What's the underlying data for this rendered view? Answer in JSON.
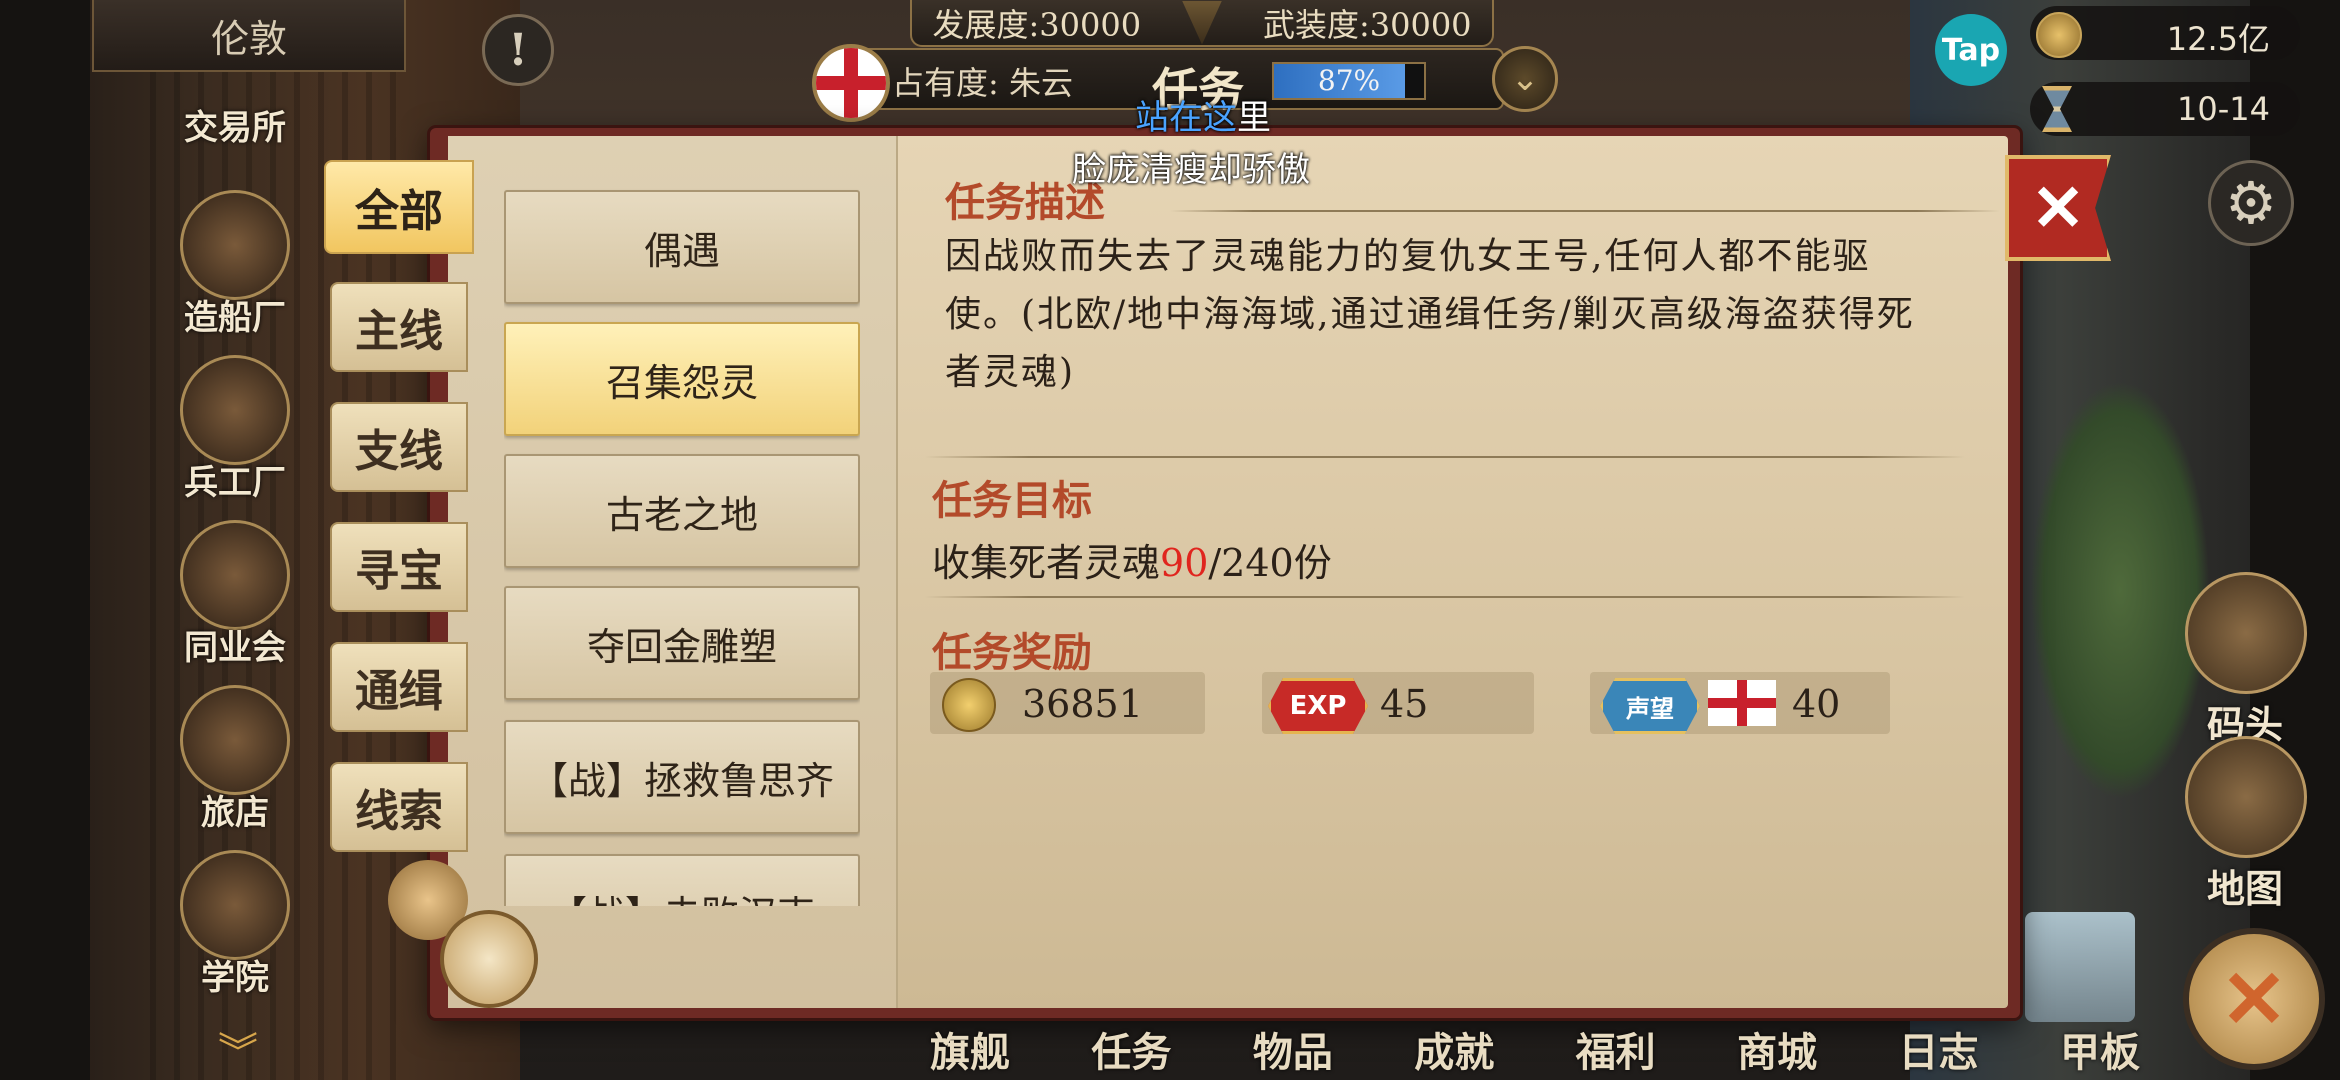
{
  "top": {
    "development_label": "发展度:",
    "development_value": "30000",
    "armament_label": "武装度:",
    "armament_value": "30000",
    "occupancy_label": "占有度: 朱云",
    "title": "任务",
    "occupancy_pct": "87%",
    "occupancy_fraction": 0.87
  },
  "captions": {
    "line1_blue": "站在这",
    "line1_white": "里",
    "line2": "脸庞清瘦却骄傲"
  },
  "resources": {
    "tap": "Tap",
    "gold": "12.5亿",
    "date": "10-14"
  },
  "city": "伦敦",
  "left_nav": [
    "交易所",
    "造船厂",
    "兵工厂",
    "同业会",
    "旅店",
    "学院"
  ],
  "tabs": [
    "全部",
    "主线",
    "支线",
    "寻宝",
    "通缉",
    "线索"
  ],
  "tasks": [
    "偶遇",
    "召集怨灵",
    "古老之地",
    "夺回金雕塑",
    "【战】拯救鲁思齐",
    "【战】击败汉克"
  ],
  "detail": {
    "desc_title": "任务描述",
    "description": "因战败而失去了灵魂能力的复仇女王号,任何人都不能驱使。(北欧/地中海海域,通过通缉任务/剿灭高级海盗获得死者灵魂)",
    "goal_title": "任务目标",
    "goal_prefix": "收集死者灵魂",
    "goal_current": "90",
    "goal_suffix": "/240份",
    "reward_title": "任务奖励",
    "reward_gold": "36851",
    "reward_exp_badge": "EXP",
    "reward_exp": "45",
    "reward_rep_badge": "声望",
    "reward_rep": "40"
  },
  "right_nav": [
    "码头",
    "地图"
  ],
  "bottom_nav": [
    "旗舰",
    "任务",
    "物品",
    "成就",
    "福利",
    "商城",
    "日志",
    "甲板"
  ],
  "colors": {
    "accent_red": "#b12a22",
    "highlight_gold": "#f1c660",
    "goal_red": "#e0251e",
    "section_title": "#b34a2a"
  }
}
